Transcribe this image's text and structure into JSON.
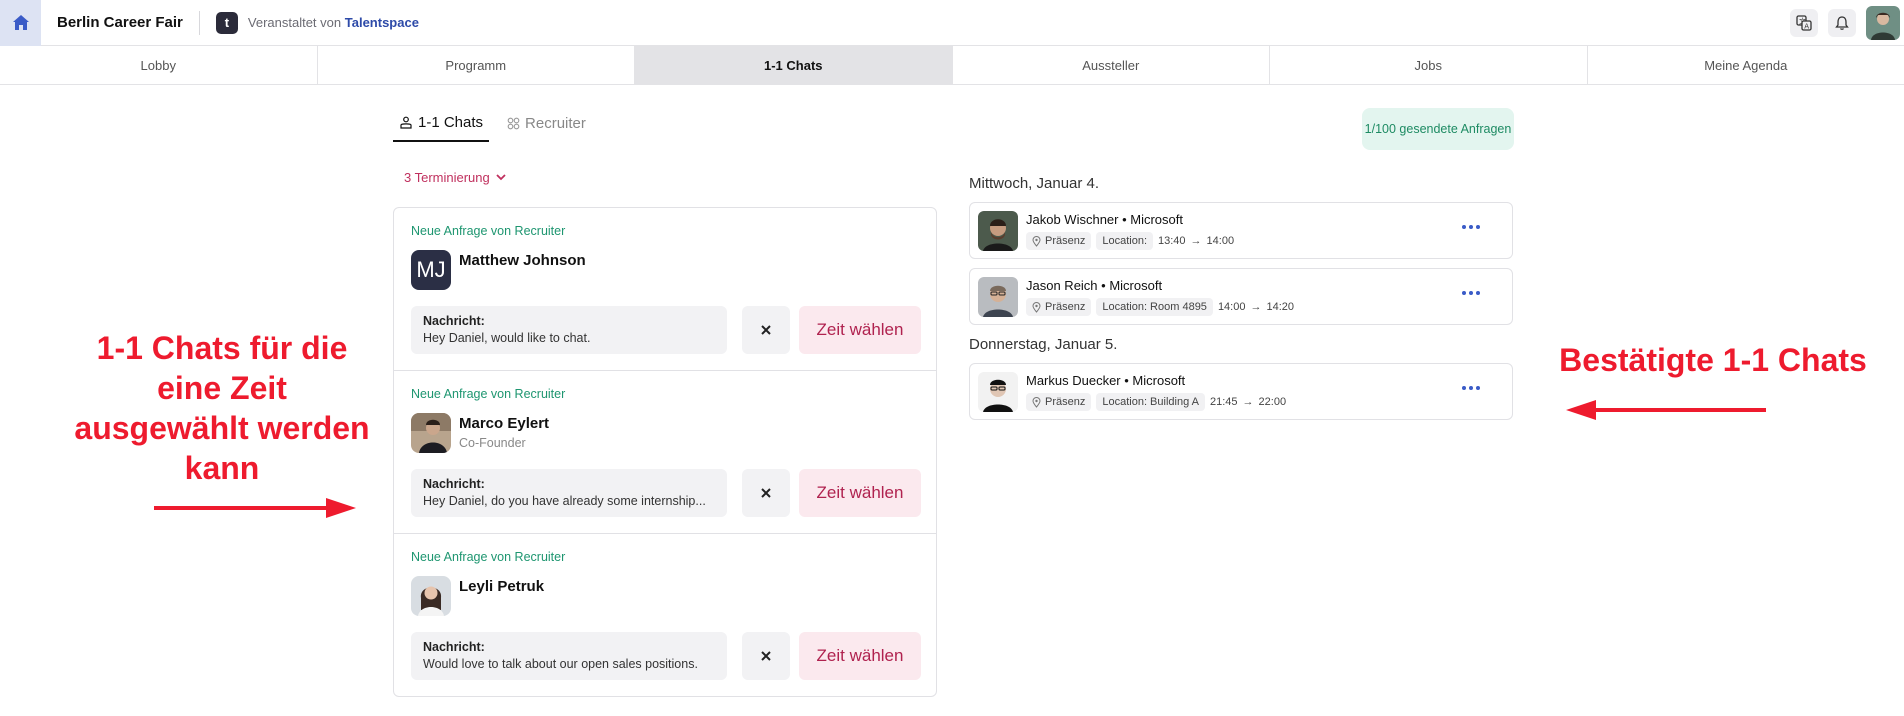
{
  "header": {
    "event_title": "Berlin Career Fair",
    "org_logo_letter": "t",
    "organizer_prefix": "Veranstaltet von",
    "organizer_name": "Talentspace"
  },
  "nav": {
    "tabs": [
      {
        "label": "Lobby"
      },
      {
        "label": "Programm"
      },
      {
        "label": "1-1 Chats"
      },
      {
        "label": "Aussteller"
      },
      {
        "label": "Jobs"
      },
      {
        "label": "Meine Agenda"
      }
    ],
    "active_index": 2
  },
  "subtabs": {
    "chats": "1-1 Chats",
    "recruiter": "Recruiter"
  },
  "requests_badge": "1/100 gesendete Anfragen",
  "filter_label": "3 Terminierung",
  "requests": [
    {
      "tag": "Neue Anfrage von Recruiter",
      "initials": "MJ",
      "name": "Matthew Johnson",
      "role": "",
      "message_label": "Nachricht:",
      "message": "Hey Daniel, would like to chat.",
      "action_label": "Zeit wählen"
    },
    {
      "tag": "Neue Anfrage von Recruiter",
      "initials": "",
      "name": "Marco Eylert",
      "role": "Co-Founder",
      "message_label": "Nachricht:",
      "message": "Hey Daniel, do you have already some internship...",
      "action_label": "Zeit wählen"
    },
    {
      "tag": "Neue Anfrage von Recruiter",
      "initials": "",
      "name": "Leyli Petruk",
      "role": "",
      "message_label": "Nachricht:",
      "message": "Would love to talk about our open sales positions.",
      "action_label": "Zeit wählen"
    }
  ],
  "schedule": [
    {
      "day": "Mittwoch, Januar 4.",
      "chats": [
        {
          "name": "Jakob Wischner",
          "company": "Microsoft",
          "mode": "Präsenz",
          "location": "Location:",
          "start": "13:40",
          "end": "14:00"
        },
        {
          "name": "Jason Reich",
          "company": "Microsoft",
          "mode": "Präsenz",
          "location": "Location: Room 4895",
          "start": "14:00",
          "end": "14:20"
        }
      ]
    },
    {
      "day": "Donnerstag, Januar 5.",
      "chats": [
        {
          "name": "Markus Duecker",
          "company": "Microsoft",
          "mode": "Präsenz",
          "location": "Location: Building A",
          "start": "21:45",
          "end": "22:00"
        }
      ]
    }
  ],
  "annotations": {
    "left": "1-1 Chats für die eine Zeit ausgewählt werden kann",
    "right": "Bestätigte 1-1 Chats"
  },
  "colors": {
    "accent_pink": "#b0224f",
    "accent_green": "#1e9670",
    "annotation_red": "#ee1b2e",
    "link_blue": "#2d4aa8"
  }
}
